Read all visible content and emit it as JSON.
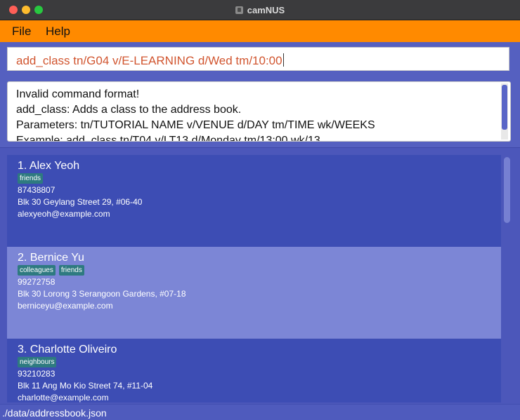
{
  "window": {
    "title": "camNUS"
  },
  "menu": {
    "items": [
      {
        "label": "File"
      },
      {
        "label": "Help"
      }
    ]
  },
  "command_box": {
    "value": "add_class tn/G04 v/E-LEARNING d/Wed tm/10:00"
  },
  "result_display": {
    "lines": [
      "Invalid command format!",
      "add_class: Adds a class to the address book.",
      "Parameters: tn/TUTORIAL NAME v/VENUE d/DAY tm/TIME wk/WEEKS",
      "Example: add_class tn/T04 v/LT13 d/Monday tm/13:00 wk/13"
    ]
  },
  "persons": [
    {
      "index_name": "1.  Alex Yeoh",
      "tags": [
        "friends"
      ],
      "phone": "87438807",
      "address": "Blk 30 Geylang Street 29, #06-40",
      "email": "alexyeoh@example.com"
    },
    {
      "index_name": "2.  Bernice Yu",
      "tags": [
        "colleagues",
        "friends"
      ],
      "phone": "99272758",
      "address": "Blk 30 Lorong 3 Serangoon Gardens, #07-18",
      "email": "berniceyu@example.com"
    },
    {
      "index_name": "3.  Charlotte Oliveiro",
      "tags": [
        "neighbours"
      ],
      "phone": "93210283",
      "address": "Blk 11 Ang Mo Kio Street 74, #11-04",
      "email": "charlotte@example.com"
    }
  ],
  "status_bar": {
    "path": "./data/addressbook.json"
  },
  "colors": {
    "menu_bar": "#ff8a00",
    "command_text": "#d1552f",
    "card_dark": "#3d4db4",
    "card_light": "#7c86d6",
    "tag": "#2e7a80"
  }
}
